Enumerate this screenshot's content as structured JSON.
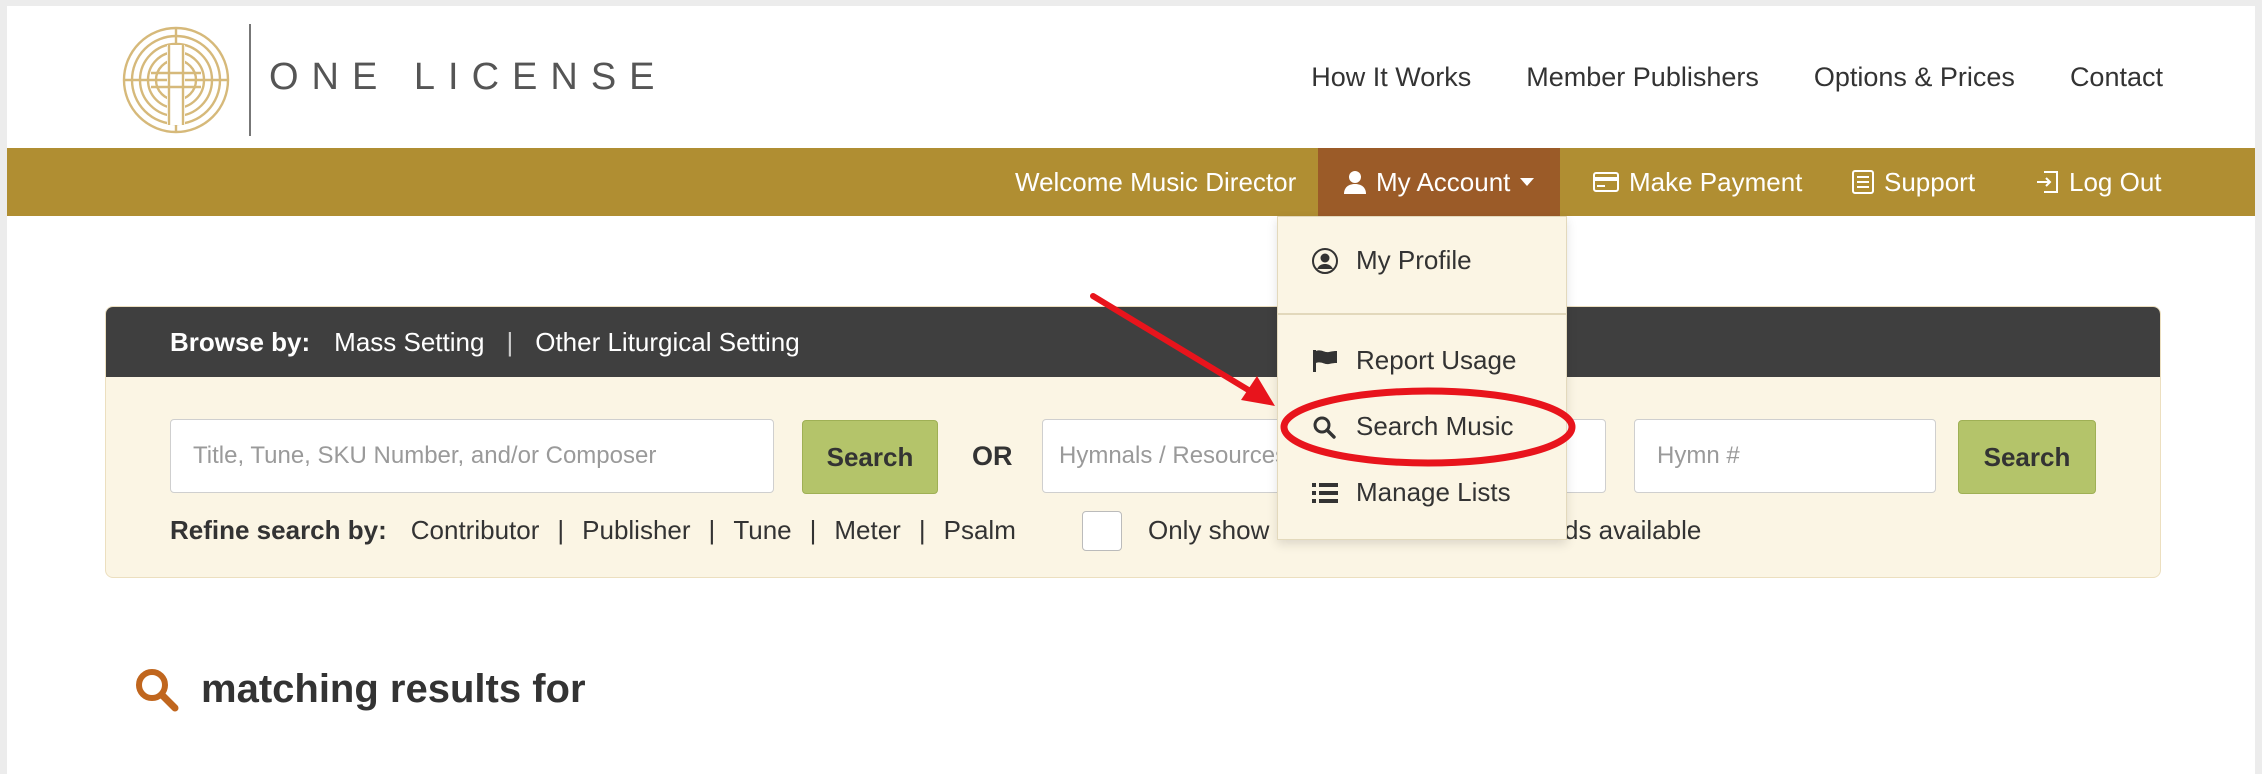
{
  "brand": {
    "name": "ONE LICENSE"
  },
  "topnav": [
    "How It Works",
    "Member Publishers",
    "Options & Prices",
    "Contact"
  ],
  "accountbar": {
    "welcome": "Welcome Music Director",
    "my_account": "My Account",
    "make_payment": "Make Payment",
    "support": "Support",
    "log_out": "Log Out"
  },
  "account_menu": {
    "my_profile": "My Profile",
    "report_usage": "Report Usage",
    "search_music": "Search Music",
    "manage_lists": "Manage Lists"
  },
  "browse": {
    "label": "Browse by:",
    "links": [
      "Mass Setting",
      "Other Liturgical Setting"
    ]
  },
  "search": {
    "title_placeholder": "Title, Tune, SKU Number, and/or Composer",
    "button": "Search",
    "or": "OR",
    "hymnal_placeholder": "Hymnals / Resources",
    "hymn_placeholder": "Hymn #",
    "button2": "Search"
  },
  "refine": {
    "label": "Refine search by:",
    "options": [
      "Contributor",
      "Publisher",
      "Tune",
      "Meter",
      "Psalm"
    ],
    "checkbox_label_start": "Only show",
    "checkbox_label_end": "ds available"
  },
  "results": {
    "title": "matching results for"
  },
  "colors": {
    "gold": "#b08e32",
    "account_active": "#9b5b28",
    "search_button": "#b4c46a",
    "annotation": "#e8141c"
  }
}
